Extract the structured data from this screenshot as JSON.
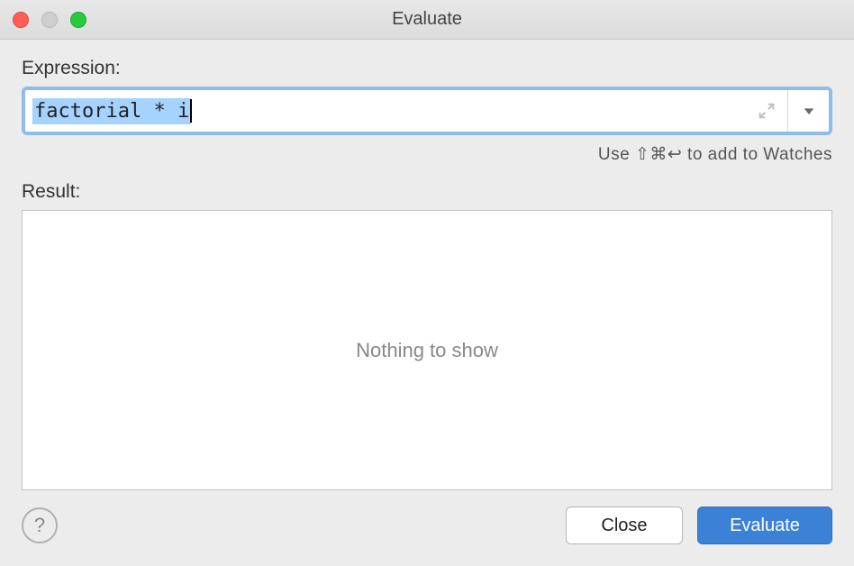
{
  "window": {
    "title": "Evaluate"
  },
  "expression": {
    "label": "Expression:",
    "value": "factorial * i"
  },
  "hint": {
    "text": "Use ⇧⌘↩ to add to Watches"
  },
  "result": {
    "label": "Result:",
    "placeholder": "Nothing to show"
  },
  "buttons": {
    "help_tooltip": "?",
    "close": "Close",
    "evaluate": "Evaluate"
  }
}
